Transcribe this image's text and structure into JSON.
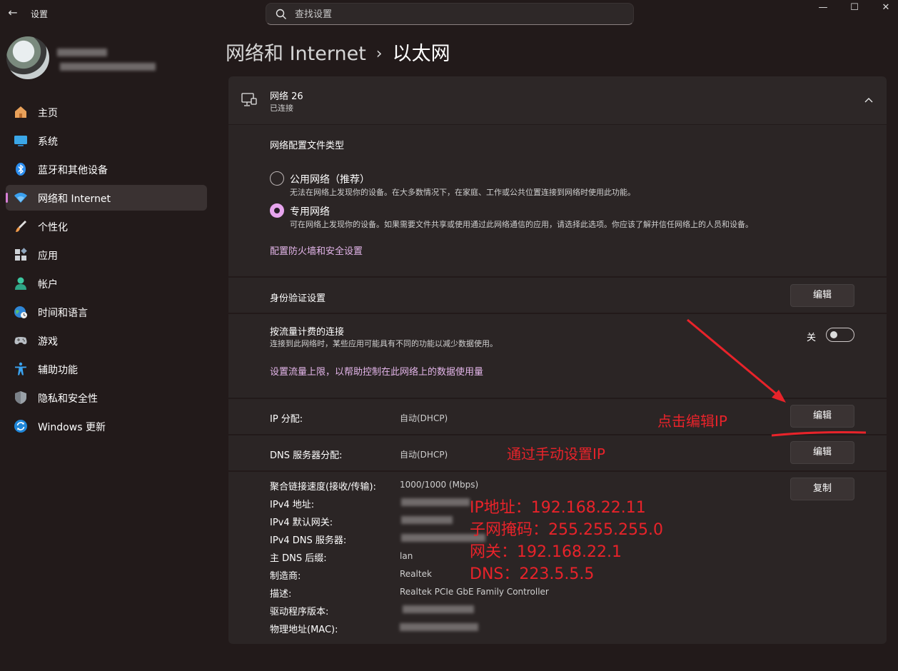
{
  "window": {
    "title": "设置",
    "minimize": "—",
    "maximize": "☐",
    "close": "✕"
  },
  "search": {
    "placeholder": "查找设置"
  },
  "sidebar": {
    "items": [
      {
        "label": "主页",
        "icon": "home-icon"
      },
      {
        "label": "系统",
        "icon": "system-icon"
      },
      {
        "label": "蓝牙和其他设备",
        "icon": "bluetooth-icon"
      },
      {
        "label": "网络和 Internet",
        "icon": "network-icon",
        "selected": true
      },
      {
        "label": "个性化",
        "icon": "brush-icon"
      },
      {
        "label": "应用",
        "icon": "apps-icon"
      },
      {
        "label": "帐户",
        "icon": "account-icon"
      },
      {
        "label": "时间和语言",
        "icon": "globe-clock-icon"
      },
      {
        "label": "游戏",
        "icon": "gamepad-icon"
      },
      {
        "label": "辅助功能",
        "icon": "accessibility-icon"
      },
      {
        "label": "隐私和安全性",
        "icon": "shield-icon"
      },
      {
        "label": "Windows 更新",
        "icon": "update-icon"
      }
    ]
  },
  "breadcrumb": {
    "parent": "网络和 Internet",
    "separator": "›",
    "current": "以太网"
  },
  "network": {
    "name": "网络 26",
    "status": "已连接",
    "profile_section_title": "网络配置文件类型",
    "profile_options": [
      {
        "label": "公用网络（推荐）",
        "description": "无法在网络上发现你的设备。在大多数情况下，在家庭、工作或公共位置连接到网络时使用此功能。",
        "checked": false
      },
      {
        "label": "专用网络",
        "description": "可在网络上发现你的设备。如果需要文件共享或使用通过此网络通信的应用，请选择此选项。你应该了解并信任网络上的人员和设备。",
        "checked": true
      }
    ],
    "firewall_link": "配置防火墙和安全设置",
    "auth_label": "身份验证设置",
    "edit_label": "编辑",
    "metered_label": "按流量计费的连接",
    "metered_description": "连接到此网络时，某些应用可能具有不同的功能以减少数据使用。",
    "metered_state": "关",
    "data_limit_link": "设置流量上限，以帮助控制在此网络上的数据使用量",
    "ip_label": "IP 分配:",
    "ip_value": "自动(DHCP)",
    "dns_label": "DNS 服务器分配:",
    "dns_value": "自动(DHCP)",
    "copy_label": "复制",
    "properties": [
      {
        "label": "聚合链接速度(接收/传输):",
        "value": "1000/1000 (Mbps)"
      },
      {
        "label": "IPv4 地址:",
        "value": ""
      },
      {
        "label": "IPv4 默认网关:",
        "value": ""
      },
      {
        "label": "IPv4 DNS 服务器:",
        "value": ""
      },
      {
        "label": "主 DNS 后缀:",
        "value": "lan"
      },
      {
        "label": "制造商:",
        "value": "Realtek"
      },
      {
        "label": "描述:",
        "value": "Realtek PCIe GbE Family Controller"
      },
      {
        "label": "驱动程序版本:",
        "value": ""
      },
      {
        "label": "物理地址(MAC):",
        "value": ""
      }
    ]
  },
  "annotations": {
    "click_edit_ip": "点击编辑IP",
    "manual_setup": "通过手动设置IP",
    "ip_address": "IP地址：192.168.22.11",
    "subnet_mask": "子网掩码：255.255.255.0",
    "gateway": "网关：192.168.22.1",
    "dns": "DNS：223.5.5.5",
    "color": "#e8232a"
  },
  "colors": {
    "accent": "#d77fd7",
    "link": "#e3b5e9",
    "background": "#221a1a",
    "panel": "#2b2525"
  }
}
